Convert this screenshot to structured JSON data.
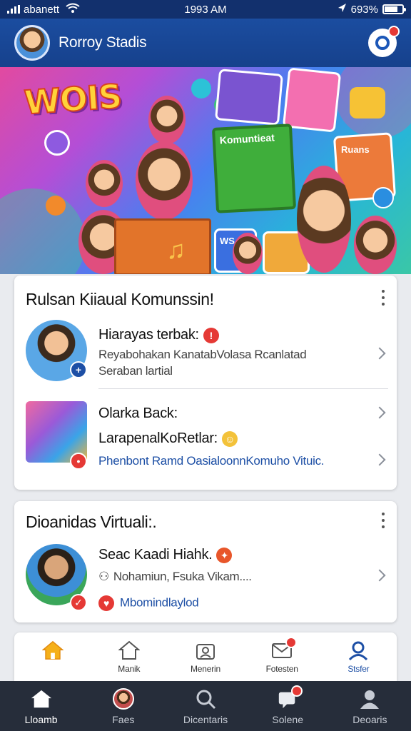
{
  "status_bar": {
    "carrier": "abanett",
    "time": "1993 AM",
    "battery": "693%"
  },
  "header": {
    "title": "Rorroy Stadis"
  },
  "banner": {
    "logo_text": "WOIS",
    "board_text": "Komuntieat",
    "card_text_1": "Ruans",
    "card_text_2": "WS"
  },
  "panel1": {
    "title": "Rulsan Kiiaual Komunssin!",
    "items": [
      {
        "title": "Hiarayas terbak:",
        "subtitle": "Reyabohakan KanatabVolasa Rcanlatad",
        "subtitle2": "Seraban lartial"
      },
      {
        "title": "Olarka Back:",
        "subtitle": "LarapenalKoRetlar:",
        "link": "Phenbont Ramd OasialoonnKomuho Vituic."
      }
    ]
  },
  "panel2": {
    "title": "Dioanidas Virtuali:.",
    "items": [
      {
        "title": "Seac Kaadi Hiahk.",
        "subtitle": "Nohamiun, Fsuka Vikam....",
        "link": "Mbomindlaylod"
      }
    ]
  },
  "inner_nav": [
    {
      "label": "",
      "icon": "home-icon"
    },
    {
      "label": "Manik",
      "icon": "home-outline-icon"
    },
    {
      "label": "Menerin",
      "icon": "user-card-icon"
    },
    {
      "label": "Fotesten",
      "icon": "mail-icon"
    },
    {
      "label": "Stsfer",
      "icon": "profile-icon"
    }
  ],
  "tabbar": [
    {
      "label": "Lloamb",
      "icon": "home-icon"
    },
    {
      "label": "Faes",
      "icon": "avatar-icon"
    },
    {
      "label": "Dicentaris",
      "icon": "search-icon"
    },
    {
      "label": "Solene",
      "icon": "chat-icon"
    },
    {
      "label": "Deoaris",
      "icon": "person-icon"
    }
  ],
  "colors": {
    "primary": "#1b4da0",
    "link": "#1d4fa5",
    "badge_red": "#e53935",
    "tabbar": "#262d3a"
  }
}
